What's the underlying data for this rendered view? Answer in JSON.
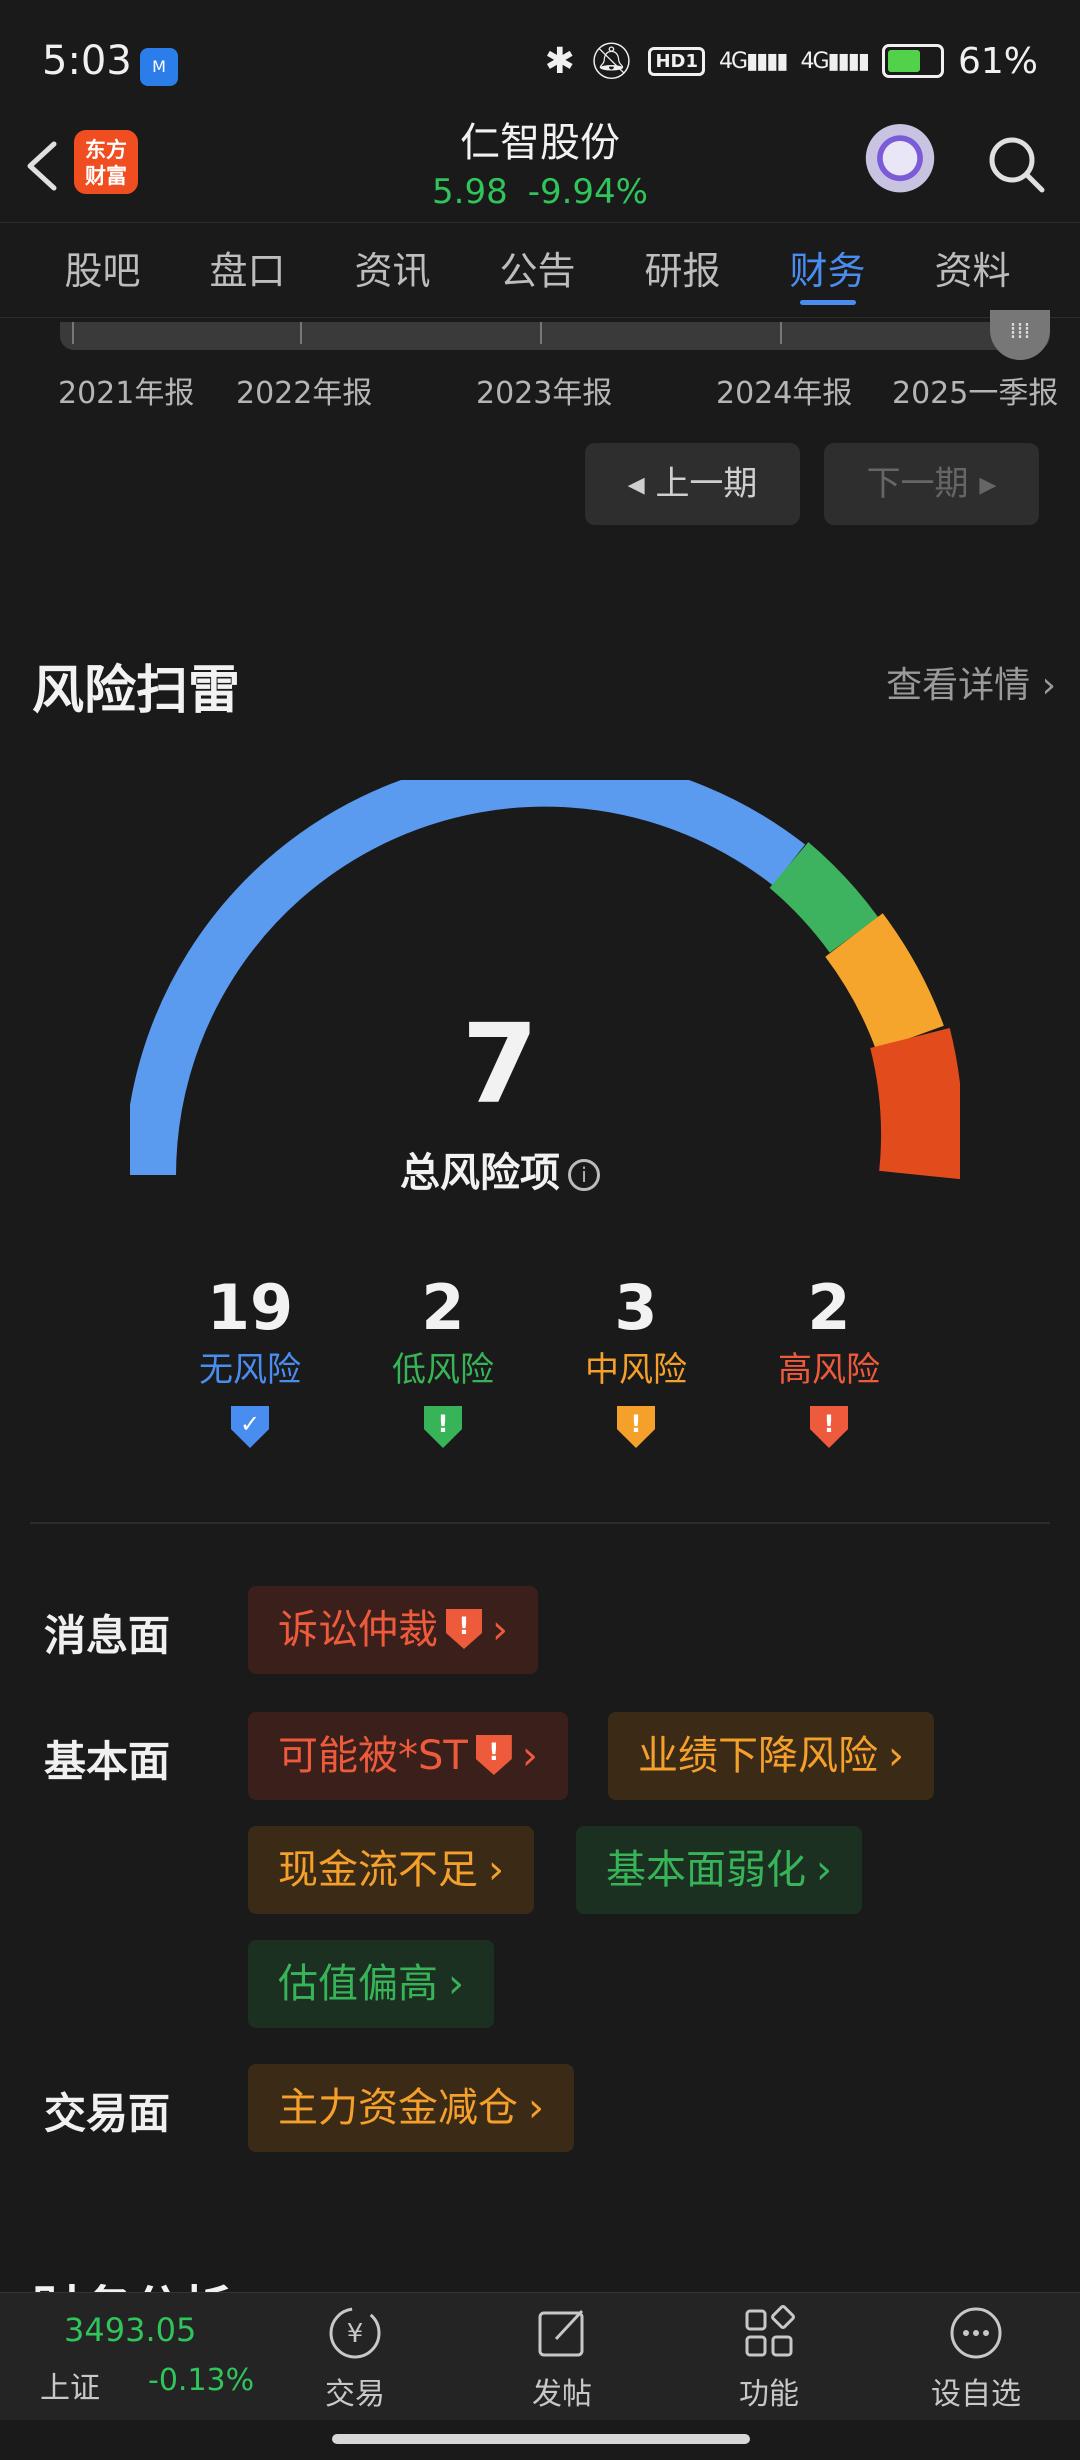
{
  "status": {
    "time": "5:03",
    "app_badge": "M",
    "hd": "HD1",
    "signal1": "4G",
    "signal2": "4G",
    "battery": "61%"
  },
  "header": {
    "logo_line1": "东方",
    "logo_line2": "财富",
    "name": "仁智股份",
    "price": "5.98",
    "change_pct": "-9.94%"
  },
  "tabs": [
    {
      "label": "股吧",
      "active": false
    },
    {
      "label": "盘口",
      "active": false
    },
    {
      "label": "资讯",
      "active": false
    },
    {
      "label": "公告",
      "active": false
    },
    {
      "label": "研报",
      "active": false
    },
    {
      "label": "财务",
      "active": true
    },
    {
      "label": "资料",
      "active": false
    }
  ],
  "timeline": {
    "labels": [
      "2021年报",
      "2022年报",
      "2023年报",
      "2024年报",
      "2025一季报"
    ],
    "selected": "2025一季报"
  },
  "period": {
    "prev": "上一期",
    "next": "下一期"
  },
  "risk": {
    "title": "风险扫雷",
    "more": "查看详情",
    "total": "7",
    "total_label": "总风险项",
    "counts": [
      {
        "value": "19",
        "label": "无风险",
        "color": "#4a8df0"
      },
      {
        "value": "2",
        "label": "低风险",
        "color": "#38b458"
      },
      {
        "value": "3",
        "label": "中风险",
        "color": "#f5a02b"
      },
      {
        "value": "2",
        "label": "高风险",
        "color": "#ee5a3c"
      }
    ],
    "gauge_colors": [
      "#5a9aef",
      "#3db35f",
      "#f5a52b",
      "#e24b1c"
    ],
    "rows": [
      {
        "label": "消息面",
        "chips": [
          {
            "text": "诉讼仲裁",
            "level": "red"
          }
        ]
      },
      {
        "label": "基本面",
        "chips": [
          {
            "text": "可能被*ST",
            "level": "red"
          },
          {
            "text": "业绩下降风险",
            "level": "orange"
          },
          {
            "text": "现金流不足",
            "level": "orange"
          },
          {
            "text": "基本面弱化",
            "level": "green"
          },
          {
            "text": "估值偏高",
            "level": "green"
          }
        ]
      },
      {
        "label": "交易面",
        "chips": [
          {
            "text": "主力资金减仓",
            "level": "orange"
          }
        ]
      }
    ]
  },
  "next_section_title": "财务分析",
  "bottom": {
    "index_value": "3493.05",
    "index_name": "上证",
    "index_change": "-0.13%",
    "nav": [
      {
        "label": "交易",
        "icon": "yuan-exchange-icon"
      },
      {
        "label": "发帖",
        "icon": "edit-icon"
      },
      {
        "label": "功能",
        "icon": "grid-icon"
      },
      {
        "label": "设自选",
        "icon": "more-icon"
      }
    ]
  }
}
